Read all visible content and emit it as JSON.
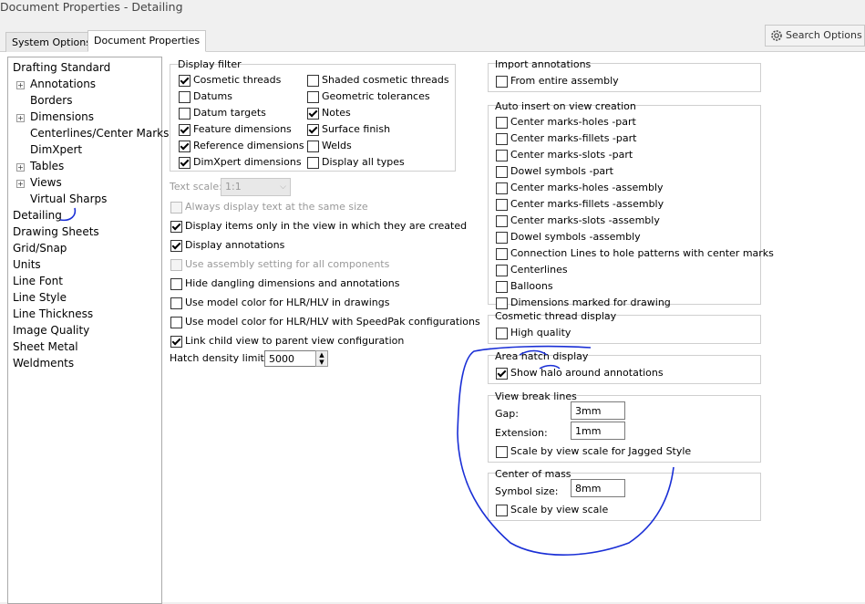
{
  "window": {
    "title": "Document Properties - Detailing"
  },
  "tabs": [
    {
      "label": "System Options"
    },
    {
      "label": "Document Properties"
    }
  ],
  "search": {
    "label": "Search Options",
    "icon": "gear-icon"
  },
  "tree": {
    "items": [
      {
        "label": "Drafting Standard"
      },
      {
        "label": "Annotations",
        "expandable": true
      },
      {
        "label": "Borders"
      },
      {
        "label": "Dimensions",
        "expandable": true
      },
      {
        "label": "Centerlines/Center Marks"
      },
      {
        "label": "DimXpert"
      },
      {
        "label": "Tables",
        "expandable": true
      },
      {
        "label": "Views",
        "expandable": true
      },
      {
        "label": "Virtual Sharps"
      },
      {
        "label": "Detailing",
        "selected": true
      },
      {
        "label": "Drawing Sheets"
      },
      {
        "label": "Grid/Snap"
      },
      {
        "label": "Units"
      },
      {
        "label": "Line Font"
      },
      {
        "label": "Line Style"
      },
      {
        "label": "Line Thickness"
      },
      {
        "label": "Image Quality"
      },
      {
        "label": "Sheet Metal"
      },
      {
        "label": "Weldments"
      }
    ]
  },
  "display_filter": {
    "title": "Display filter",
    "left": [
      {
        "label": "Cosmetic threads",
        "checked": true
      },
      {
        "label": "Datums",
        "checked": false
      },
      {
        "label": "Datum targets",
        "checked": false
      },
      {
        "label": "Feature dimensions",
        "checked": true
      },
      {
        "label": "Reference dimensions",
        "checked": true
      },
      {
        "label": "DimXpert dimensions",
        "checked": true
      }
    ],
    "right": [
      {
        "label": "Shaded cosmetic threads",
        "checked": false
      },
      {
        "label": "Geometric tolerances",
        "checked": false
      },
      {
        "label": "Notes",
        "checked": true
      },
      {
        "label": "Surface finish",
        "checked": true
      },
      {
        "label": "Welds",
        "checked": false
      },
      {
        "label": "Display all types",
        "checked": false
      }
    ]
  },
  "text_scale": {
    "label": "Text scale:",
    "value": "1:1"
  },
  "options": [
    {
      "label": "Always display text at the same size",
      "checked": false,
      "disabled": true
    },
    {
      "label": "Display items only in the view in which they are created",
      "checked": true
    },
    {
      "label": "Display annotations",
      "checked": true
    },
    {
      "label": "Use assembly setting for all components",
      "checked": false,
      "disabled": true
    },
    {
      "label": "Hide dangling dimensions and annotations",
      "checked": false
    },
    {
      "label": "Use model color for HLR/HLV in drawings",
      "checked": false
    },
    {
      "label": "Use model color for HLR/HLV with SpeedPak configurations",
      "checked": false
    },
    {
      "label": "Link child view to parent view configuration",
      "checked": true
    }
  ],
  "hatch_density": {
    "label": "Hatch density limit:",
    "value": "5000"
  },
  "import_annotations": {
    "title": "Import annotations",
    "items": [
      {
        "label": "From entire assembly",
        "checked": false
      }
    ]
  },
  "auto_insert": {
    "title": "Auto insert on view creation",
    "items": [
      {
        "label": "Center marks-holes -part",
        "checked": false
      },
      {
        "label": "Center marks-fillets -part",
        "checked": false
      },
      {
        "label": "Center marks-slots  -part",
        "checked": false
      },
      {
        "label": "Dowel symbols -part",
        "checked": false
      },
      {
        "label": "Center marks-holes -assembly",
        "checked": false
      },
      {
        "label": "Center marks-fillets -assembly",
        "checked": false
      },
      {
        "label": "Center marks-slots  -assembly",
        "checked": false
      },
      {
        "label": "Dowel symbols -assembly",
        "checked": false
      },
      {
        "label": "Connection Lines to hole patterns with center marks",
        "checked": false
      },
      {
        "label": "Centerlines",
        "checked": false
      },
      {
        "label": "Balloons",
        "checked": false
      },
      {
        "label": "Dimensions marked for drawing",
        "checked": false
      }
    ]
  },
  "cosmetic_thread_display": {
    "title": "Cosmetic thread display",
    "items": [
      {
        "label": "High quality",
        "checked": false
      }
    ]
  },
  "area_hatch_display": {
    "title": "Area hatch display",
    "items": [
      {
        "label": "Show halo around annotations",
        "checked": true
      }
    ]
  },
  "view_break_lines": {
    "title": "View break lines",
    "gap": {
      "label": "Gap:",
      "value": "3mm"
    },
    "extension": {
      "label": "Extension:",
      "value": "1mm"
    },
    "items": [
      {
        "label": "Scale by view scale for Jagged Style",
        "checked": false
      }
    ]
  },
  "center_of_mass": {
    "title": "Center of mass",
    "symbol_size": {
      "label": "Symbol size:",
      "value": "8mm"
    },
    "items": [
      {
        "label": "Scale by view scale",
        "checked": false
      }
    ]
  },
  "colors": {
    "annotation_ink": "#1a2fd6",
    "selected_bg": "#ffffff"
  }
}
